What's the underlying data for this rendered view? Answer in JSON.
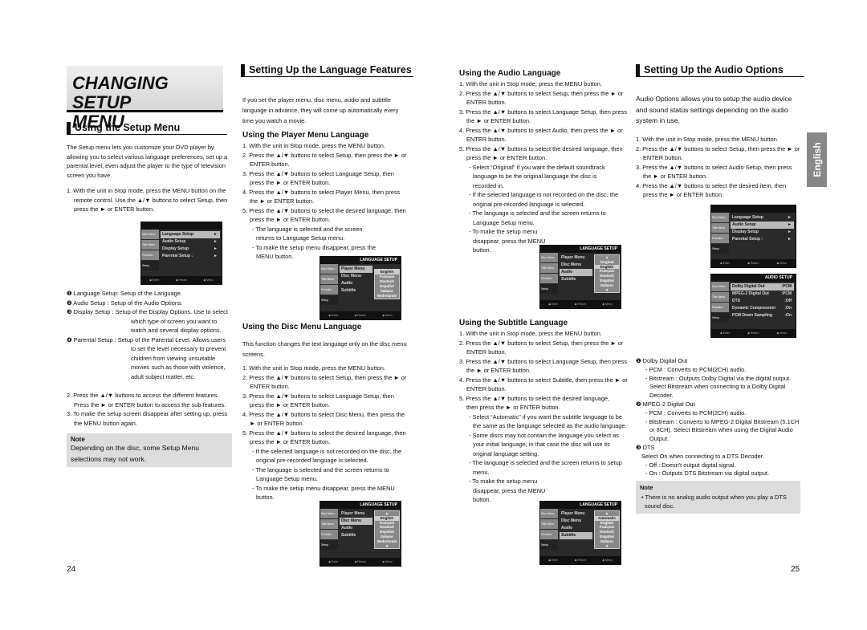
{
  "left_page": {
    "title_line1": "CHANGING SETUP",
    "title_line2": "MENU",
    "section_heading": "Using the Setup Menu",
    "intro": "The Setup menu lets you customize your DVD player by allowing you to select various language preferences, set up a parental level, even adjust the player to the type of television screen you have.",
    "step1": "1. With the unit in Stop mode, press the MENU button on the remote control. Use the ▲/▼ buttons to select Setup, then press the ► or ENTER button.",
    "definitions": [
      "❶ Language Setup: Setup of the Language.",
      "❷ Audio Setup : Setup of the Audio Options.",
      "❸ Display Setup : Setup of the Display Options. Use to select which type of screen you want to watch and several display options.",
      "❹ Parental Setup : Setup of the Parental Level. Allows users to set the level necessary to prevent children from viewing unsuitable movies such as those with violence, adult subject matter, etc."
    ],
    "step2": "2. Press the ▲/▼ buttons to access the different features. Press the ► or ENTER button to access the sub features.",
    "step3": "3. To make the setup screen disappear after setting up, press the MENU button again.",
    "note_title": "Note",
    "note_text": "Depending on the disc, some Setup Menu selections may not work.",
    "page_number": "24"
  },
  "setup_menu": {
    "side": [
      "Disc Menu",
      "Title Menu",
      "Function",
      "Setup"
    ],
    "items": [
      "Language Setup",
      "Audio Setup",
      "Display Setup",
      "Parental Setup :"
    ],
    "footer": [
      "◆ Enter",
      "◆ Return",
      "◆ Menu"
    ]
  },
  "language_features": {
    "heading": "Setting Up the Language Features",
    "intro": "If you set the player menu, disc menu, audio and subtitle language in advance, they will come up automatically every time you watch a movie.",
    "player_menu": {
      "heading": "Using the Player Menu Language",
      "steps": [
        "1. With the unit in Stop mode, press the MENU button.",
        "2. Press the ▲/▼ buttons to select Setup, then press the ► or ENTER button.",
        "3. Press the ▲/▼ buttons to select Language Setup, then press the ► or ENTER button.",
        "4. Press the ▲/▼ buttons to select Player Menu, then press the ► or ENTER button.",
        "5. Press the ▲/▼ buttons to select the desired language, then press the ► or ENTER button."
      ],
      "subs": [
        "- The language is selected and the screen returns to Language Setup menu.",
        "- To make the setup menu disappear, press the MENU button."
      ]
    },
    "disc_menu": {
      "heading": "Using the Disc Menu Language",
      "intro": "This function changes the text language only on the disc menu screens.",
      "steps": [
        "1. With the unit in Stop mode, press the MENU button.",
        "2. Press the ▲/▼ buttons to select Setup, then press the ► or ENTER button.",
        "3. Press the ▲/▼ buttons to select Language Setup, then press the ► or ENTER button.",
        "4. Press the ▲/▼ buttons to select Disc Menu, then press the ► or ENTER button.",
        "5. Press the ▲/▼ buttons to select the desired language, then press the ► or ENTER button."
      ],
      "subs": [
        "- If the selected language is not recorded on the disc, the original pre-recorded language is selected.",
        "- The language is selected and the screen returns to Language Setup menu.",
        "- To make the setup menu disappear, press the MENU button."
      ]
    }
  },
  "lang_menu": {
    "header": "LANGUAGE SETUP",
    "items": [
      "Player Menu",
      "Disc Menu",
      "Audio",
      "Subtitle"
    ],
    "player_opts": [
      "English",
      "Français",
      "Deutsch",
      "Español",
      "Italiano",
      "Nederlands"
    ],
    "disc_opts": [
      "▲",
      "English",
      "Français",
      "Deutsch",
      "Español",
      "Italiano",
      "Nederlands",
      "▼"
    ],
    "audio_opts": [
      "▲",
      "Original",
      "English",
      "Français",
      "Deutsch",
      "Español",
      "Italiano",
      "▼"
    ],
    "subtitle_opts": [
      "▲",
      "Automatic",
      "English",
      "Français",
      "Deutsch",
      "Español",
      "Italiano",
      "▼"
    ]
  },
  "audio_language": {
    "heading": "Using the Audio Language",
    "steps": [
      "1. With the unit in Stop mode, press the MENU button.",
      "2. Press the ▲/▼ buttons to select Setup, then press the ► or ENTER button.",
      "3. Press the ▲/▼ buttons to select Language Setup, then press the ► or ENTER button.",
      "4. Press the ▲/▼ buttons to select Audio, then press the ► or ENTER button.",
      "5. Press the ▲/▼ buttons to select the desired language, then press the ► or ENTER button."
    ],
    "subs": [
      "- Select “Original” if you want the default soundtrack language to be the original language the disc is recorded in.",
      "- If the selected language is not recorded on the disc, the original pre-recorded language is selected.",
      "- The language is selected and the screen returns to Language Setup menu.",
      "- To make the setup menu disappear, press the MENU button."
    ]
  },
  "subtitle_language": {
    "heading": "Using the Subtitle Language",
    "steps": [
      "1. With the unit in Stop mode, press the MENU button.",
      "2. Press the ▲/▼ buttons to select Setup, then press the ► or ENTER button.",
      "3. Press the ▲/▼ buttons to select Language Setup, then press the ► or ENTER button.",
      "4. Press the ▲/▼ buttons to select Subtitle, then press the ► or ENTER button.",
      "5. Press the ▲/▼ buttons to select the desired language, then press the ► or ENTER button."
    ],
    "subs": [
      "- Select “Automatic” if you want the subtitle language to be the same as the language selected as the audio language.",
      "- Some discs may not contain the language you select as your initial language; in that case the disc will use its original language setting.",
      "- The language is selected and the screen returns to setup menu.",
      "- To make the setup menu disappear, press the MENU button."
    ]
  },
  "audio_options": {
    "heading": "Setting Up the Audio Options",
    "intro": "Audio Options allows you to setup the audio device and sound status settings depending on the audio system in use.",
    "steps": [
      "1. With the unit in Stop mode, press the MENU button.",
      "2. Press the ▲/▼ buttons to select Setup, then press the ► or ENTER button.",
      "3. Press the ▲/▼ buttons to select Audio Setup, then press the ► or ENTER button.",
      "4. Press the ▲/▼ buttons to select the desired item, then press the ► or ENTER button."
    ],
    "audio_menu_header": "AUDIO SETUP",
    "audio_menu_items": [
      {
        "label": "Dolby Digital Out",
        "value": ":PCM"
      },
      {
        "label": "MPEG-2 Digital Out",
        "value": ":PCM"
      },
      {
        "label": "DTS",
        "value": ":Off"
      },
      {
        "label": "Dynamic Compression",
        "value": ":On"
      },
      {
        "label": "PCM Down Sampling",
        "value": ":On"
      }
    ],
    "details": [
      "❶ Dolby Digital Out",
      "- PCM : Converts to PCM(2CH) audio.",
      "- Bitstream : Outputs Dolby Digital via the digital output. Select Bitstream when connecting to a Dolby Digital Decoder.",
      "❷ MPEG-2 Digital Out",
      "- PCM : Converts to PCM(2CH) audio.",
      "- Bitstream : Converts to MPEG-2 Digital Bitstream (5.1CH or 8CH). Select Bitstream when using the Digital Audio Output.",
      "❸ DTS",
      "Select On when connecting to a DTS Decoder.",
      "- Off : Doesn't output digital signal.",
      "- On : Outputs DTS Bitstream via digital output."
    ],
    "note_title": "Note",
    "note_text": "• There is no analog audio output when you play a DTS sound disc."
  },
  "side_tab": "English",
  "right_page_number": "25"
}
